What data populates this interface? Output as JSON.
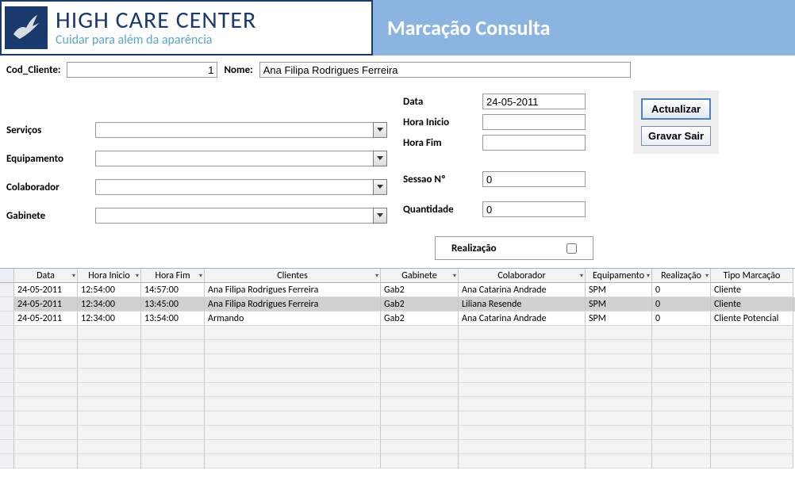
{
  "logo": {
    "title": "HIGH CARE CENTER",
    "subtitle": "Cuidar para além da aparência"
  },
  "page_title": "Marcação Consulta",
  "top": {
    "cod_cliente_label": "Cod_Cliente:",
    "cod_cliente_value": "1",
    "nome_label": "Nome:",
    "nome_value": "Ana Filipa Rodrigues Ferreira"
  },
  "left_fields": {
    "servicos_label": "Serviços",
    "servicos_value": "",
    "equipamento_label": "Equipamento",
    "equipamento_value": "",
    "colaborador_label": "Colaborador",
    "colaborador_value": "",
    "gabinete_label": "Gabinete",
    "gabinete_value": ""
  },
  "right_fields": {
    "data_label": "Data",
    "data_value": "24-05-2011",
    "hora_inicio_label": "Hora Inicio",
    "hora_inicio_value": "",
    "hora_fim_label": "Hora Fim",
    "hora_fim_value": "",
    "sessao_label": "Sessao Nº",
    "sessao_value": "0",
    "quant_label": "Quantidade",
    "quant_value": "0",
    "realizacao_label": "Realização",
    "realizacao_checked": false
  },
  "buttons": {
    "actualizar": "Actualizar",
    "gravar_sair": "Gravar Sair"
  },
  "grid": {
    "columns": [
      "Data",
      "Hora Inicio",
      "Hora Fim",
      "Clientes",
      "Gabinete",
      "Colaborador",
      "Equipamento",
      "Realização",
      "Tipo Marcação"
    ],
    "rows": [
      {
        "data": "24-05-2011",
        "hini": "12:54:00",
        "hfim": "14:57:00",
        "cli": "Ana Filipa Rodrigues Ferreira",
        "gab": "Gab2",
        "colab": "Ana Catarina Andrade",
        "equip": "SPM",
        "real": "0",
        "tipo": "Cliente",
        "selected": false
      },
      {
        "data": "24-05-2011",
        "hini": "12:34:00",
        "hfim": "13:45:00",
        "cli": "Ana Filipa Rodrigues Ferreira",
        "gab": "Gab2",
        "colab": "Liliana Resende",
        "equip": "SPM",
        "real": "0",
        "tipo": "Cliente",
        "selected": true
      },
      {
        "data": "24-05-2011",
        "hini": "12:34:00",
        "hfim": "13:54:00",
        "cli": "Armando",
        "gab": "Gab2",
        "colab": "Ana Catarina Andrade",
        "equip": "SPM",
        "real": "0",
        "tipo": "Cliente Potencial",
        "selected": false
      }
    ],
    "empty_rows": 10
  }
}
